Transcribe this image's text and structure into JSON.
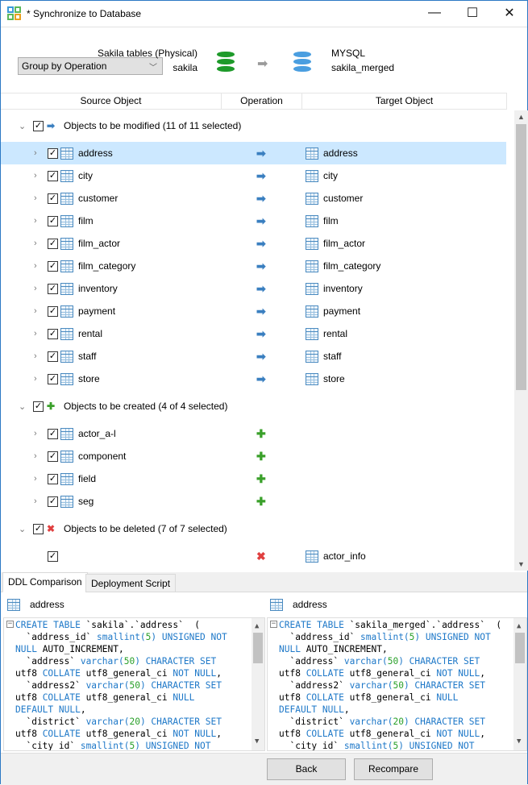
{
  "window": {
    "title": "* Synchronize to Database",
    "controls": [
      "—",
      "☐",
      "✕"
    ]
  },
  "header": {
    "group_select": "Group by Operation",
    "source_label": "Sakila tables (Physical)",
    "source_db": "sakila",
    "target_label": "MYSQL",
    "target_db": "sakila_merged",
    "source_db_color": "#1e9a2a",
    "target_db_color": "#4a9ee0"
  },
  "columns": [
    "Source Object",
    "Operation",
    "Target Object"
  ],
  "groups": [
    {
      "label": "Objects to be modified (11 of 11 selected)",
      "op": "modify",
      "checked": true,
      "items": [
        {
          "source": "address",
          "target": "address",
          "selected": true
        },
        {
          "source": "city",
          "target": "city"
        },
        {
          "source": "customer",
          "target": "customer"
        },
        {
          "source": "film",
          "target": "film"
        },
        {
          "source": "film_actor",
          "target": "film_actor"
        },
        {
          "source": "film_category",
          "target": "film_category"
        },
        {
          "source": "inventory",
          "target": "inventory"
        },
        {
          "source": "payment",
          "target": "payment"
        },
        {
          "source": "rental",
          "target": "rental"
        },
        {
          "source": "staff",
          "target": "staff"
        },
        {
          "source": "store",
          "target": "store"
        }
      ]
    },
    {
      "label": "Objects to be created (4 of 4 selected)",
      "op": "create",
      "checked": true,
      "items": [
        {
          "source": "actor_a-l",
          "target": ""
        },
        {
          "source": "component",
          "target": ""
        },
        {
          "source": "field",
          "target": ""
        },
        {
          "source": "seg",
          "target": ""
        }
      ]
    },
    {
      "label": "Objects to be deleted (7 of 7 selected)",
      "op": "delete",
      "checked": true,
      "items": [
        {
          "source": "",
          "target": "actor_info",
          "target_icon": "view-icon"
        }
      ]
    }
  ],
  "op_icons": {
    "modify": {
      "glyph": "➡",
      "color": "#3a7fc0"
    },
    "create": {
      "glyph": "✚",
      "color": "#3aa02a"
    },
    "delete": {
      "glyph": "✖",
      "color": "#e04040"
    }
  },
  "tabs": [
    {
      "label": "DDL Comparison",
      "active": true
    },
    {
      "label": "Deployment Script",
      "active": false
    }
  ],
  "ddl": {
    "left": {
      "title": "address",
      "lines": [
        [
          [
            "CREATE TABLE",
            "k"
          ],
          [
            " `sakila`.`address`  (",
            ""
          ]
        ],
        [
          [
            "  `address_id` ",
            ""
          ],
          [
            "smallint(",
            "k"
          ],
          [
            "5",
            "n"
          ],
          [
            ") ",
            "k"
          ],
          [
            "UNSIGNED NOT",
            "k"
          ]
        ],
        [
          [
            "NULL",
            "k"
          ],
          [
            " AUTO_INCREMENT,",
            ""
          ]
        ],
        [
          [
            "  `address` ",
            ""
          ],
          [
            "varchar(",
            "k"
          ],
          [
            "50",
            "n"
          ],
          [
            ") CHARACTER SET",
            "k"
          ]
        ],
        [
          [
            "utf8 ",
            ""
          ],
          [
            "COLLATE",
            "k"
          ],
          [
            " utf8_general_ci ",
            ""
          ],
          [
            "NOT NULL",
            "k"
          ],
          [
            ",",
            ""
          ]
        ],
        [
          [
            "  `address2` ",
            ""
          ],
          [
            "varchar(",
            "k"
          ],
          [
            "50",
            "n"
          ],
          [
            ") CHARACTER SET",
            "k"
          ]
        ],
        [
          [
            "utf8 ",
            ""
          ],
          [
            "COLLATE",
            "k"
          ],
          [
            " utf8_general_ci ",
            ""
          ],
          [
            "NULL",
            "k"
          ]
        ],
        [
          [
            "DEFAULT NULL",
            "k"
          ],
          [
            ",",
            ""
          ]
        ],
        [
          [
            "  `district` ",
            ""
          ],
          [
            "varchar(",
            "k"
          ],
          [
            "20",
            "n"
          ],
          [
            ") CHARACTER SET",
            "k"
          ]
        ],
        [
          [
            "utf8 ",
            ""
          ],
          [
            "COLLATE",
            "k"
          ],
          [
            " utf8_general_ci ",
            ""
          ],
          [
            "NOT NULL",
            "k"
          ],
          [
            ",",
            ""
          ]
        ],
        [
          [
            "  `city_id` ",
            ""
          ],
          [
            "smallint(",
            "k"
          ],
          [
            "5",
            "n"
          ],
          [
            ") UNSIGNED NOT",
            "k"
          ]
        ]
      ]
    },
    "right": {
      "title": "address",
      "lines": [
        [
          [
            "CREATE TABLE",
            "k"
          ],
          [
            " `sakila_merged`.`address`  (",
            ""
          ]
        ],
        [
          [
            "  `address_id` ",
            ""
          ],
          [
            "smallint(",
            "k"
          ],
          [
            "5",
            "n"
          ],
          [
            ") ",
            "k"
          ],
          [
            "UNSIGNED NOT",
            "k"
          ]
        ],
        [
          [
            "NULL",
            "k"
          ],
          [
            " AUTO_INCREMENT,",
            ""
          ]
        ],
        [
          [
            "  `address` ",
            ""
          ],
          [
            "varchar(",
            "k"
          ],
          [
            "50",
            "n"
          ],
          [
            ") CHARACTER SET",
            "k"
          ]
        ],
        [
          [
            "utf8 ",
            ""
          ],
          [
            "COLLATE",
            "k"
          ],
          [
            " utf8_general_ci ",
            ""
          ],
          [
            "NOT NULL",
            "k"
          ],
          [
            ",",
            ""
          ]
        ],
        [
          [
            "  `address2` ",
            ""
          ],
          [
            "varchar(",
            "k"
          ],
          [
            "50",
            "n"
          ],
          [
            ") CHARACTER SET",
            "k"
          ]
        ],
        [
          [
            "utf8 ",
            ""
          ],
          [
            "COLLATE",
            "k"
          ],
          [
            " utf8_general_ci ",
            ""
          ],
          [
            "NULL",
            "k"
          ]
        ],
        [
          [
            "DEFAULT NULL",
            "k"
          ],
          [
            ",",
            ""
          ]
        ],
        [
          [
            "  `district` ",
            ""
          ],
          [
            "varchar(",
            "k"
          ],
          [
            "20",
            "n"
          ],
          [
            ") CHARACTER SET",
            "k"
          ]
        ],
        [
          [
            "utf8 ",
            ""
          ],
          [
            "COLLATE",
            "k"
          ],
          [
            " utf8_general_ci ",
            ""
          ],
          [
            "NOT NULL",
            "k"
          ],
          [
            ",",
            ""
          ]
        ],
        [
          [
            "  `city_id` ",
            ""
          ],
          [
            "smallint(",
            "k"
          ],
          [
            "5",
            "n"
          ],
          [
            ") UNSIGNED NOT",
            "k"
          ]
        ]
      ]
    }
  },
  "footer": {
    "back": "Back",
    "recompare": "Recompare"
  }
}
